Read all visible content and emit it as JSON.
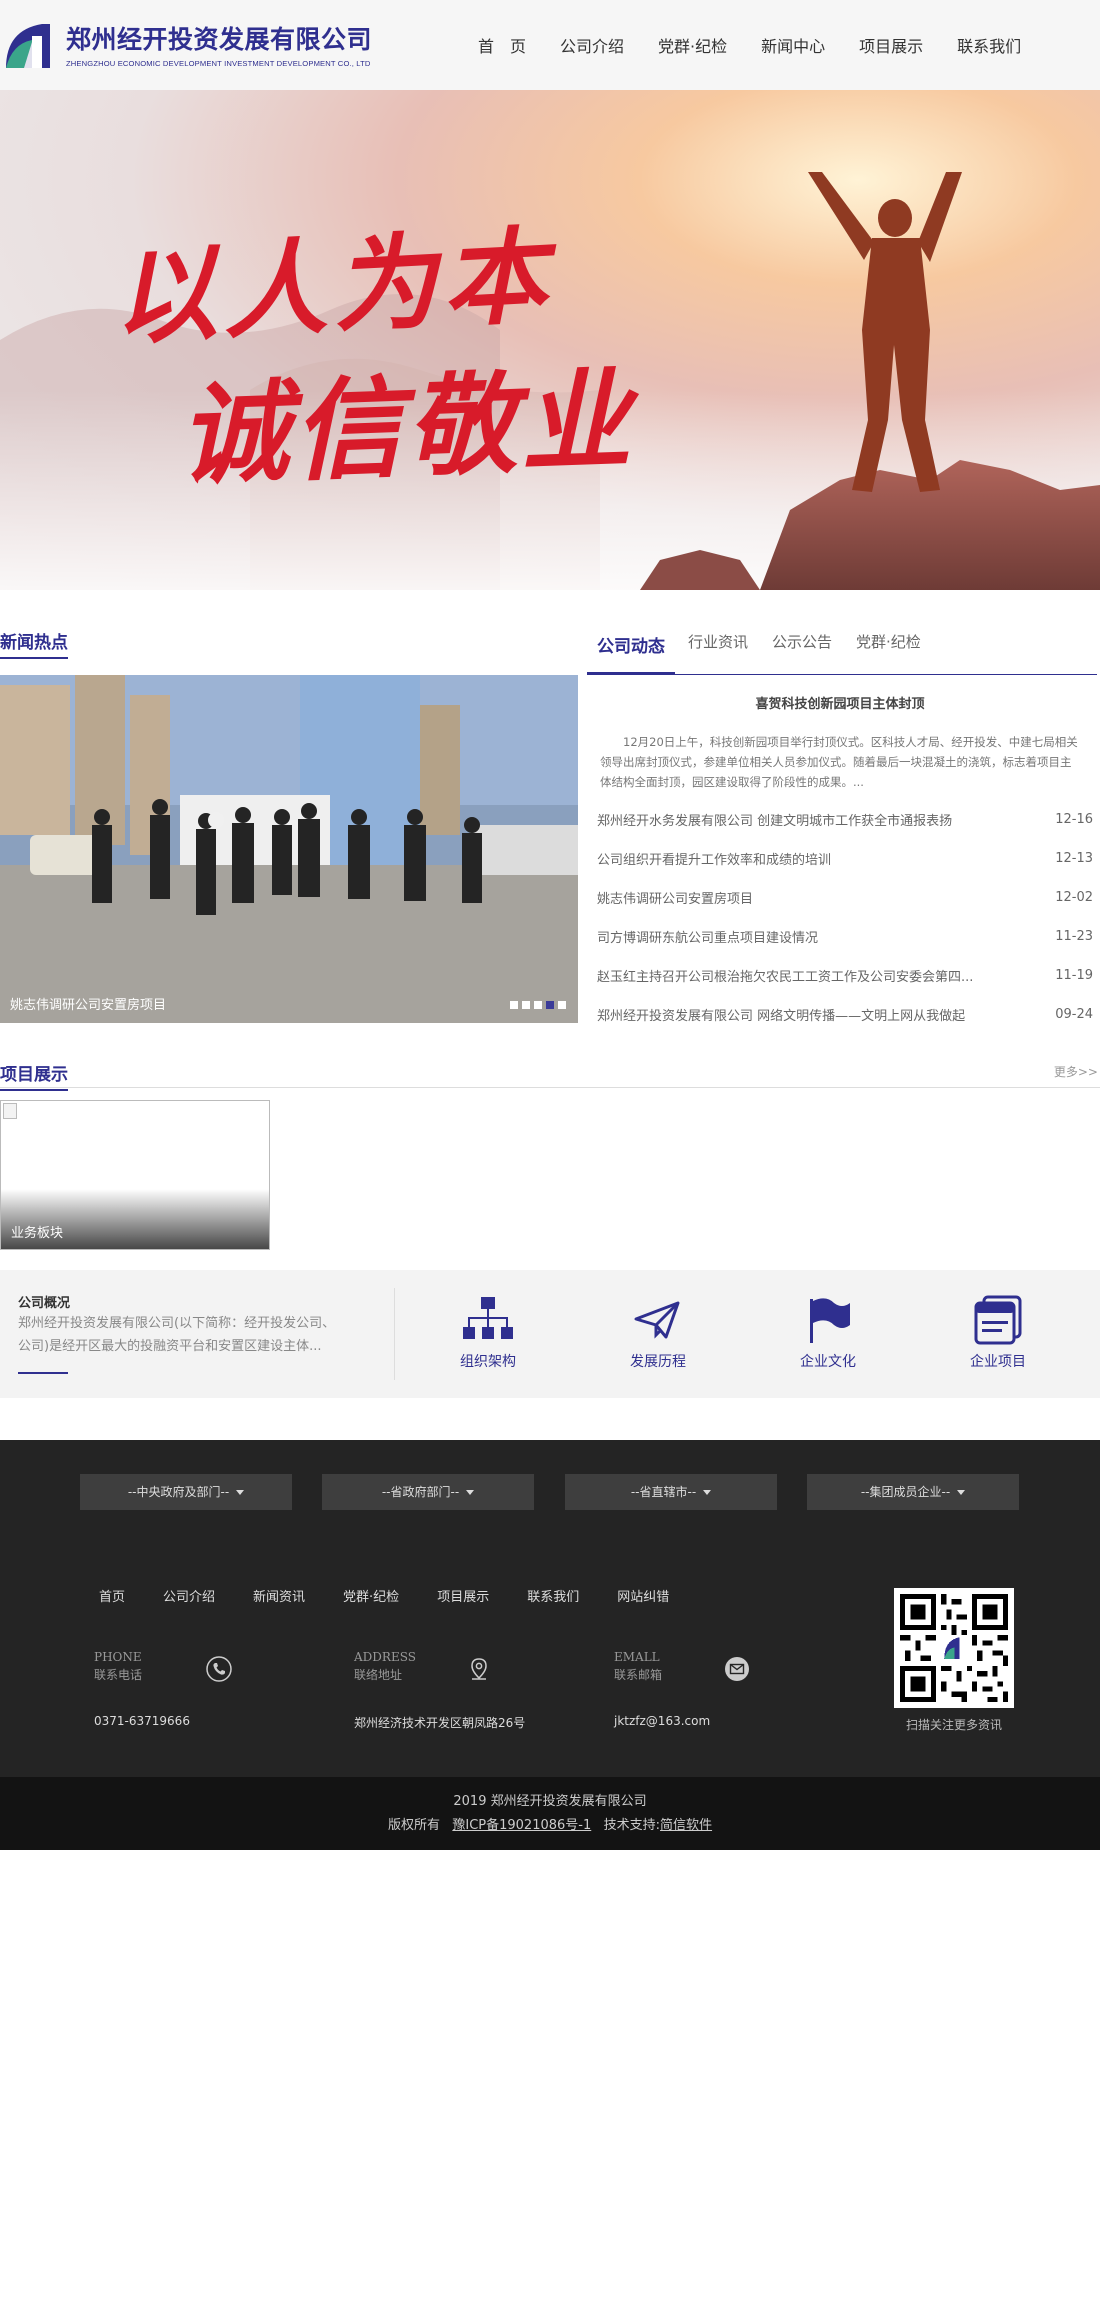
{
  "header": {
    "logo_cn": "郑州经开投资发展有限公司",
    "logo_en": "ZHENGZHOU ECONOMIC DEVELOPMENT INVESTMENT DEVELOPMENT CO., LTD",
    "nav": [
      "首　页",
      "公司介绍",
      "党群·纪检",
      "新闻中心",
      "项目展示",
      "联系我们"
    ]
  },
  "banner": {
    "line1": "以人为本",
    "line2": "诚信敬业"
  },
  "news": {
    "section_title": "新闻热点",
    "photo_caption": "姚志伟调研公司安置房项目",
    "slider_count": 5,
    "slider_active": 4,
    "tabs": [
      "公司动态",
      "行业资讯",
      "公示公告",
      "党群·纪检"
    ],
    "feature_title": "喜贺科技创新园项目主体封顶",
    "feature_text": "12月20日上午，科技创新园项目举行封顶仪式。区科技人才局、经开投发、中建七局相关领导出席封顶仪式，参建单位相关人员参加仪式。随着最后一块混凝土的浇筑，标志着项目主体结构全面封顶，园区建设取得了阶段性的成果。...",
    "items": [
      {
        "title": "郑州经开水务发展有限公司 创建文明城市工作获全市通报表扬",
        "date": "12-16"
      },
      {
        "title": "公司组织开看提升工作效率和成绩的培训",
        "date": "12-13"
      },
      {
        "title": "姚志伟调研公司安置房项目",
        "date": "12-02"
      },
      {
        "title": "司方博调研东航公司重点项目建设情况",
        "date": "11-23"
      },
      {
        "title": "赵玉红主持召开公司根治拖欠农民工工资工作及公司安委会第四...",
        "date": "11-19"
      },
      {
        "title": "郑州经开投资发展有限公司 网络文明传播——文明上网从我做起",
        "date": "09-24"
      }
    ]
  },
  "projects": {
    "section_title": "项目展示",
    "more": "更多>>",
    "card_label": "业务板块"
  },
  "overview": {
    "title": "公司概况",
    "text": "郑州经开投资发展有限公司(以下简称：经开投发公司、公司)是经开区最大的投融资平台和安置区建设主体...",
    "items": [
      {
        "label": "组织架构",
        "icon": "org-chart-icon"
      },
      {
        "label": "发展历程",
        "icon": "paper-plane-icon"
      },
      {
        "label": "企业文化",
        "icon": "flag-icon"
      },
      {
        "label": "企业项目",
        "icon": "project-stack-icon"
      }
    ]
  },
  "footer": {
    "dropdowns": [
      "--中央政府及部门--",
      "--省政府部门--",
      "--省直辖市--",
      "--集团成员企业--"
    ],
    "nav": [
      "首页",
      "公司介绍",
      "新闻资讯",
      "党群·纪检",
      "项目展示",
      "联系我们",
      "网站纠错"
    ],
    "contacts": [
      {
        "en": "PHONE",
        "cn": "联系电话",
        "value": "0371-63719666",
        "icon": "phone-icon"
      },
      {
        "en": "ADDRESS",
        "cn": "联络地址",
        "value": "郑州经济技术开发区朝凤路26号",
        "icon": "location-pin-icon"
      },
      {
        "en": "EMALL",
        "cn": "联系邮箱",
        "value": "jktzfz@163.com",
        "icon": "mail-icon"
      }
    ],
    "qr_caption": "扫描关注更多资讯",
    "copy_line1": "2019 郑州经开投资发展有限公司",
    "copy_rights": "版权所有",
    "icp": "豫ICP备19021086号-1",
    "support_label": "技术支持:",
    "support": "简信软件"
  },
  "colors": {
    "brand": "#2f2f8f",
    "footer_bg": "#242424",
    "copyright_bg": "#131313"
  }
}
